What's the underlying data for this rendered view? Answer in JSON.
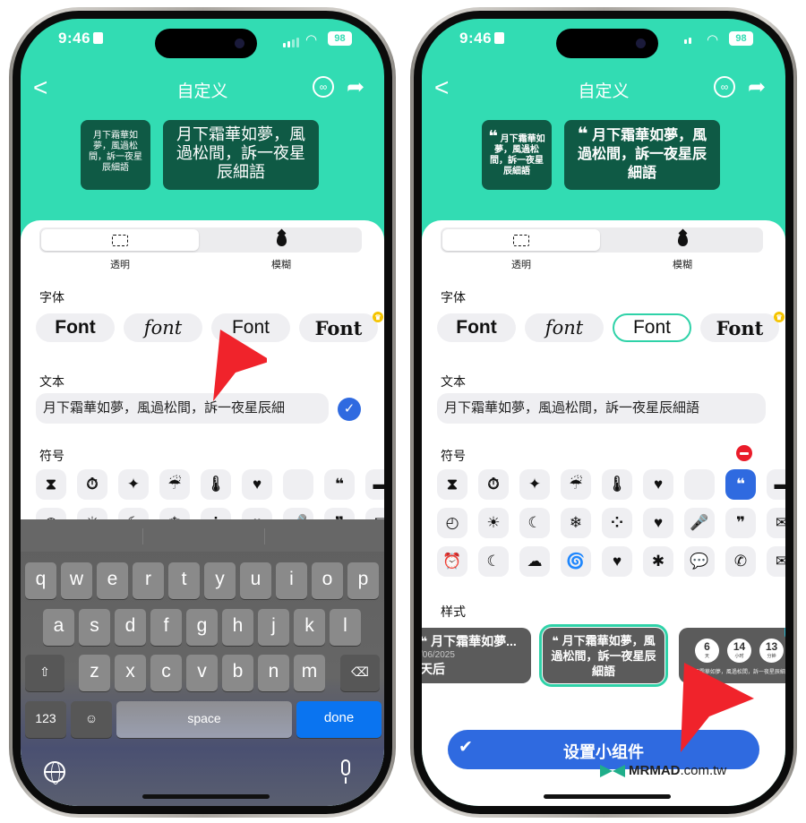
{
  "status_bar": {
    "time": "9:46",
    "battery": "98"
  },
  "nav": {
    "back_label": "<",
    "title": "自定义"
  },
  "colors": {
    "accent": "#32dcb3",
    "preview_bg": "#0f5a45",
    "primary_blue": "#2f6ae0",
    "selected_outline": "#2fd2a8",
    "keyboard_done": "#0a74f0",
    "remove_badge": "#ea1c2a",
    "watermark_green": "#1fae8a"
  },
  "left_phone": {
    "preview_small": "月下霜華如夢，風過松間，訴一夜星辰細語",
    "preview_medium": "月下霜華如夢，風過松間，訴一夜星辰細語",
    "background_options": [
      {
        "label": "透明",
        "icon": "dashed-rect-icon",
        "selected": true
      },
      {
        "label": "模糊",
        "icon": "drop-icon",
        "selected": false
      }
    ],
    "font_section_title": "字体",
    "fonts": [
      {
        "label": "Font",
        "style": "bold-sans"
      },
      {
        "label": "font",
        "style": "script"
      },
      {
        "label": "Font",
        "style": "rounded"
      },
      {
        "label": "Font",
        "style": "blackletter",
        "premium": true
      }
    ],
    "text_section_title": "文本",
    "text_value": "月下霜華如夢，風過松間，訴一夜星辰細",
    "symbol_section_title": "符号",
    "symbols_row1": [
      "⧗",
      "⏱",
      "✦",
      "☔",
      "🌡",
      "♥",
      "",
      "❝",
      "▬"
    ],
    "symbols_row2": [
      "◴",
      "☀",
      "☾",
      "❄",
      "⁘",
      "♥",
      "🎤",
      "❞",
      "✉"
    ],
    "keyboard": {
      "row1": [
        "q",
        "w",
        "e",
        "r",
        "t",
        "y",
        "u",
        "i",
        "o",
        "p"
      ],
      "row2": [
        "a",
        "s",
        "d",
        "f",
        "g",
        "h",
        "j",
        "k",
        "l"
      ],
      "row3": [
        "z",
        "x",
        "c",
        "v",
        "b",
        "n",
        "m"
      ],
      "shift": "⇧",
      "delete": "⌫",
      "numbers": "123",
      "emoji": "☺",
      "space": "space",
      "done": "done"
    }
  },
  "right_phone": {
    "preview_small": "月下霜華如夢，風過松間，訴一夜星辰細語",
    "preview_medium": "月下霜華如夢，風過松間，訴一夜星辰細語",
    "quote_glyph": "❝",
    "background_options": [
      {
        "label": "透明",
        "icon": "dashed-rect-icon",
        "selected": true
      },
      {
        "label": "模糊",
        "icon": "drop-icon",
        "selected": false
      }
    ],
    "font_section_title": "字体",
    "fonts": [
      {
        "label": "Font",
        "style": "bold-sans"
      },
      {
        "label": "font",
        "style": "script"
      },
      {
        "label": "Font",
        "style": "rounded",
        "selected": true
      },
      {
        "label": "Font",
        "style": "blackletter",
        "premium": true
      }
    ],
    "text_section_title": "文本",
    "text_value": "月下霜華如夢，風過松間，訴一夜星辰細語",
    "symbol_section_title": "符号",
    "symbols_row1": [
      "⧗",
      "⏱",
      "✦",
      "☔",
      "🌡",
      "♥",
      "",
      "❝",
      "▬"
    ],
    "symbols_row2": [
      "◴",
      "☀",
      "☾",
      "❄",
      "⁘",
      "♥",
      "🎤",
      "❞",
      "✉"
    ],
    "symbols_row3": [
      "⏰",
      "☾",
      "☁",
      "🌀",
      "♥",
      "✱",
      "💬",
      "✆",
      "✉"
    ],
    "selected_symbol_index": 7,
    "style_section_title": "样式",
    "styles": [
      {
        "line1": "❝ 月下霜華如夢...",
        "line2": "/06/2025",
        "line3": "天后"
      },
      {
        "line1": "❝ 月下霜華如夢，風過松間，訴一夜星辰細語",
        "selected": true
      },
      {
        "countdown": [
          {
            "value": "6",
            "unit": "天"
          },
          {
            "value": "14",
            "unit": "小时"
          },
          {
            "value": "13",
            "unit": "分钟"
          }
        ],
        "caption": "❝ 月下霜華如夢，風過松間，訴一夜星辰細語",
        "badge": "P"
      }
    ],
    "set_widget_button": "设置小组件",
    "set_widget_check": "✔"
  },
  "watermark": {
    "brand": "MRMAD",
    "suffix": ".com.tw"
  }
}
